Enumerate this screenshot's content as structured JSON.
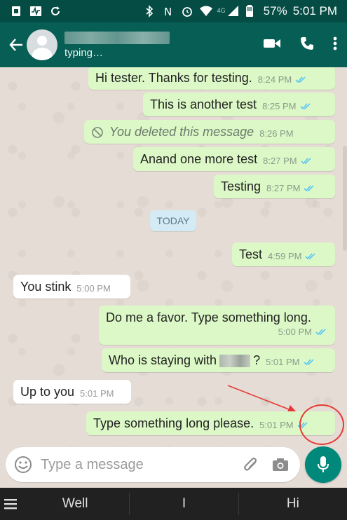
{
  "status_bar": {
    "battery": "57%",
    "time": "5:01 PM",
    "network": "4G"
  },
  "header": {
    "typing_text": "typing…"
  },
  "messages": [
    {
      "text": "Hi tester. Thanks for testing.",
      "time": "8:24 PM",
      "direction": "out"
    },
    {
      "text": "This is another test",
      "time": "8:25 PM",
      "direction": "out"
    },
    {
      "text": "You deleted this message",
      "time": "8:26 PM",
      "direction": "out",
      "deleted": true
    },
    {
      "text": "Anand one more test",
      "time": "8:27 PM",
      "direction": "out"
    },
    {
      "text": "Testing",
      "time": "8:27 PM",
      "direction": "out"
    },
    {
      "text": "Test",
      "time": "4:59 PM",
      "direction": "out"
    },
    {
      "text": "You stink",
      "time": "5:00 PM",
      "direction": "in"
    },
    {
      "text": "Do me a favor. Type something long.",
      "time": "5:00 PM",
      "direction": "out"
    },
    {
      "text": "Who is staying with",
      "text_end": "?",
      "time": "5:01 PM",
      "direction": "out"
    },
    {
      "text": "Up to you",
      "time": "5:01 PM",
      "direction": "in"
    },
    {
      "text": "Type something long please.",
      "time": "5:01 PM",
      "direction": "out"
    }
  ],
  "date_divider": "TODAY",
  "composer": {
    "placeholder": "Type a message"
  },
  "keyboard": {
    "suggestions": [
      "Well",
      "I",
      "Hi"
    ]
  },
  "colors": {
    "header": "#075e54",
    "status_bar": "#054c44",
    "outgoing_bubble": "#dcf8c6",
    "incoming_bubble": "#ffffff",
    "read_ticks": "#4fc3f7",
    "mic_button": "#00897b",
    "annotation": "#e53935"
  }
}
